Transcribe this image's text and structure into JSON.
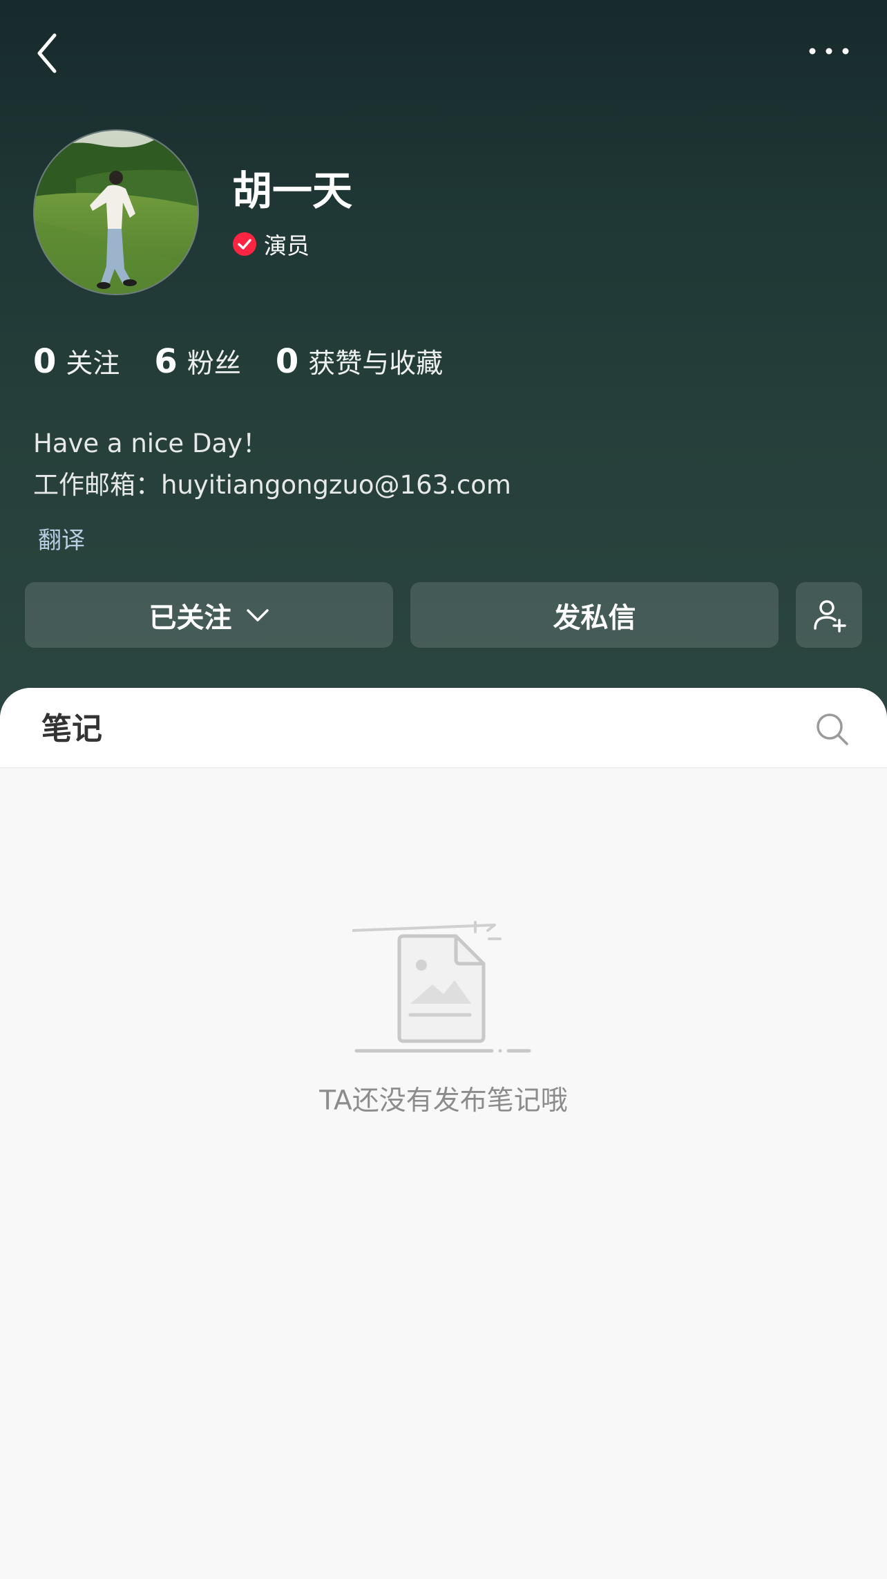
{
  "profile": {
    "name": "胡一天",
    "verification": "演员",
    "stats": [
      {
        "value": "0",
        "label": "关注"
      },
      {
        "value": "6",
        "label": "粉丝"
      },
      {
        "value": "0",
        "label": "获赞与收藏"
      }
    ],
    "bio_lines": [
      "Have a nice Day！",
      "工作邮箱：huyitiangongzuo@163.com"
    ],
    "translate_label": "翻译"
  },
  "actions": {
    "following_label": "已关注",
    "message_label": "发私信"
  },
  "tabs": {
    "notes_label": "笔记"
  },
  "empty_state": {
    "message": "TA还没有发布笔记哦"
  },
  "icons": {
    "back": "chevron-left-icon",
    "more": "more-dots-icon",
    "verified": "verified-check-icon",
    "dropdown": "chevron-down-icon",
    "add_user": "add-user-icon",
    "search": "search-icon",
    "empty": "empty-document-icon"
  },
  "colors": {
    "header_top": "#172a2c",
    "header_bottom": "#2b4540",
    "verified_badge": "#ff2442",
    "translate_link": "#b9cde0",
    "empty_text": "#8c8c8c"
  }
}
